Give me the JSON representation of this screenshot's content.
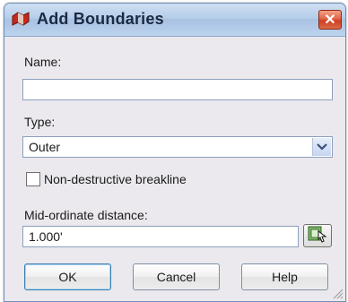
{
  "window": {
    "title": "Add Boundaries",
    "close_glyph": "✕",
    "app_icon": "boundary-app-icon"
  },
  "form": {
    "name_label": "Name:",
    "name_value": "",
    "type_label": "Type:",
    "type_value": "Outer",
    "breakline_label": "Non-destructive breakline",
    "breakline_checked": false,
    "midord_label": "Mid-ordinate distance:",
    "midord_value": "1.000'",
    "pick_icon": "pick-from-drawing-icon"
  },
  "buttons": {
    "ok": "OK",
    "cancel": "Cancel",
    "help": "Help"
  },
  "colors": {
    "title_bar": "#b6cde8",
    "close_button": "#cf3e1e",
    "dialog_bg": "#ebe9ed"
  }
}
